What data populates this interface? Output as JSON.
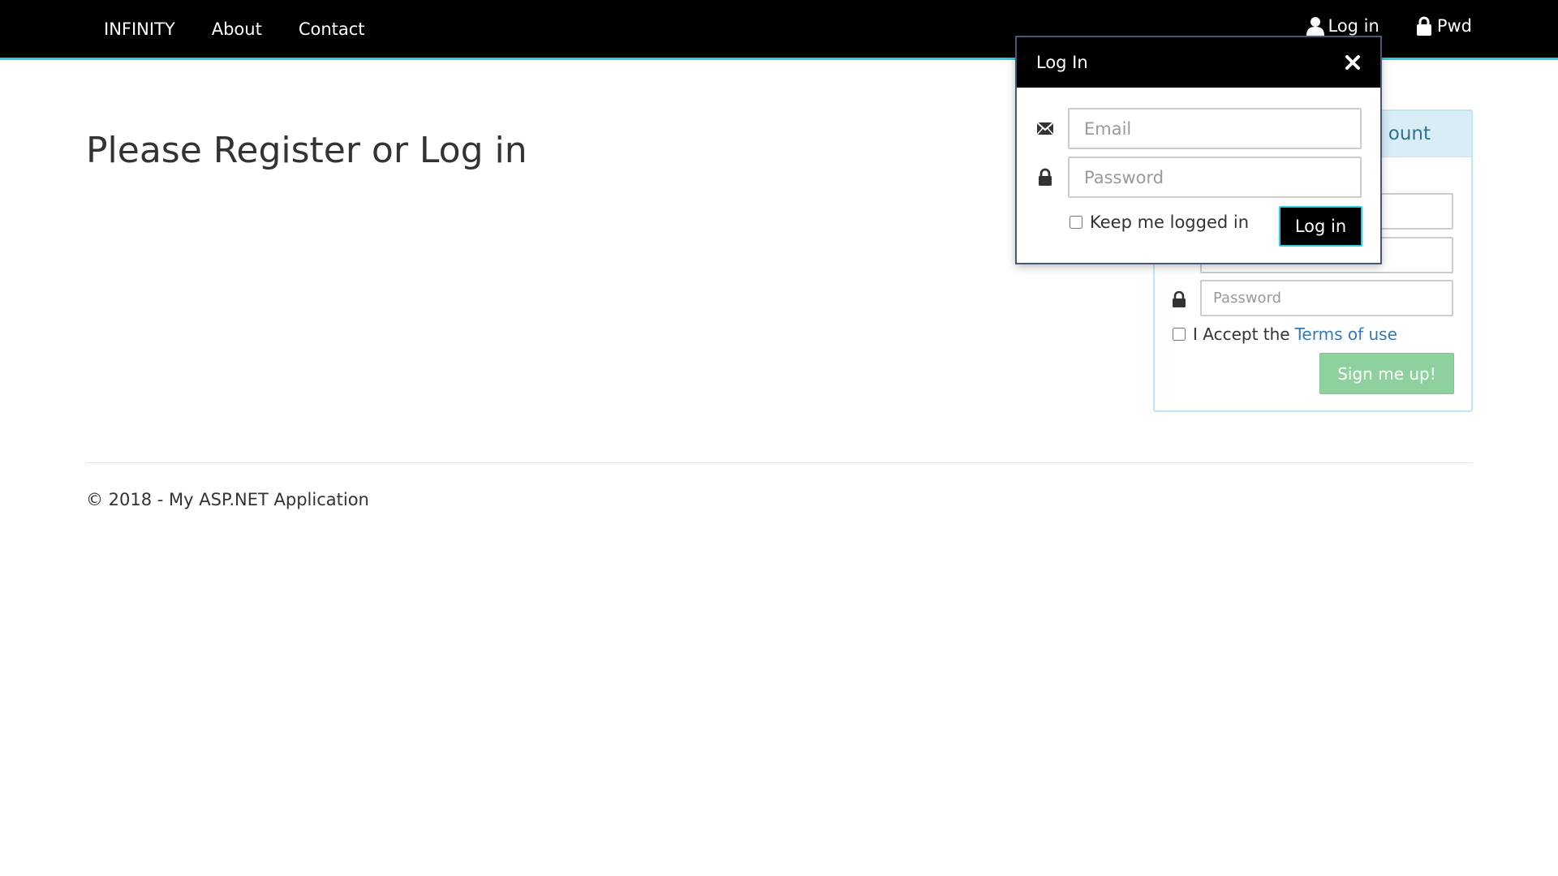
{
  "navbar": {
    "brand": "INFINITY",
    "links": [
      {
        "label": "About"
      },
      {
        "label": "Contact"
      }
    ],
    "right": {
      "login_label": "Log in",
      "pwd_label": "Pwd"
    }
  },
  "main": {
    "title": "Please Register or Log in"
  },
  "register_panel": {
    "heading": "Create an Account",
    "visible_heading_fragment": "ount",
    "password_placeholder": "Password",
    "accept_text": "I Accept the",
    "terms_link": "Terms of use",
    "signup_label": "Sign me up!"
  },
  "login_popup": {
    "title": "Log In",
    "email_placeholder": "Email",
    "password_placeholder": "Password",
    "keep_logged_in": "Keep me logged in",
    "login_button": "Log in"
  },
  "footer": {
    "text": "© 2018 - My ASP.NET Application"
  },
  "colors": {
    "navbar_bg": "#000000",
    "accent_cyan": "#2ad0e0",
    "panel_heading_bg": "#d9edf7",
    "panel_heading_text": "#31708f",
    "link": "#337ab7",
    "signup_btn": "#8fd19e"
  },
  "icons": {
    "nav_login": "user-icon",
    "nav_pwd": "lock-icon",
    "popup_email": "envelope-icon",
    "popup_password": "lock-icon",
    "popup_close": "close-icon"
  }
}
